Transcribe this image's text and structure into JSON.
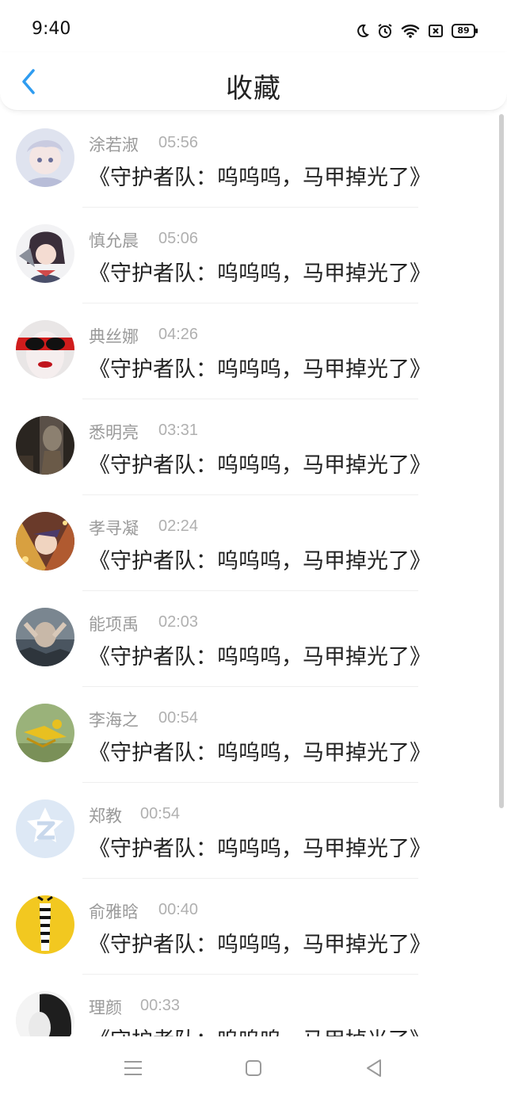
{
  "status": {
    "time": "9:40",
    "battery": "89"
  },
  "header": {
    "title": "收藏"
  },
  "items": [
    {
      "name": "涂若淑",
      "time": "05:56",
      "title": "《守护者队：呜呜呜，马甲掉光了》"
    },
    {
      "name": "慎允晨",
      "time": "05:06",
      "title": "《守护者队：呜呜呜，马甲掉光了》"
    },
    {
      "name": "典丝娜",
      "time": "04:26",
      "title": "《守护者队：呜呜呜，马甲掉光了》"
    },
    {
      "name": "悉明亮",
      "time": "03:31",
      "title": "《守护者队：呜呜呜，马甲掉光了》"
    },
    {
      "name": "孝寻凝",
      "time": "02:24",
      "title": "《守护者队：呜呜呜，马甲掉光了》"
    },
    {
      "name": "能项禹",
      "time": "02:03",
      "title": "《守护者队：呜呜呜，马甲掉光了》"
    },
    {
      "name": "李海之",
      "time": "00:54",
      "title": "《守护者队：呜呜呜，马甲掉光了》"
    },
    {
      "name": "郑教",
      "time": "00:54",
      "title": "《守护者队：呜呜呜，马甲掉光了》"
    },
    {
      "name": "俞雅晗",
      "time": "00:40",
      "title": "《守护者队：呜呜呜，马甲掉光了》"
    },
    {
      "name": "理颜",
      "time": "00:33",
      "title": "《守护者队：呜呜呜，马甲掉光了》"
    }
  ],
  "colors": {
    "accent": "#2f9cf0",
    "title": "#222222",
    "name": "#9a9a9a",
    "time": "#b0b0b0"
  },
  "icons": {
    "status": [
      "moon-icon",
      "alarm-icon",
      "wifi-icon",
      "sim-icon",
      "battery-icon"
    ],
    "header": "chevron-left-icon",
    "nav": [
      "menu-icon",
      "home-square-icon",
      "back-triangle-icon"
    ]
  }
}
